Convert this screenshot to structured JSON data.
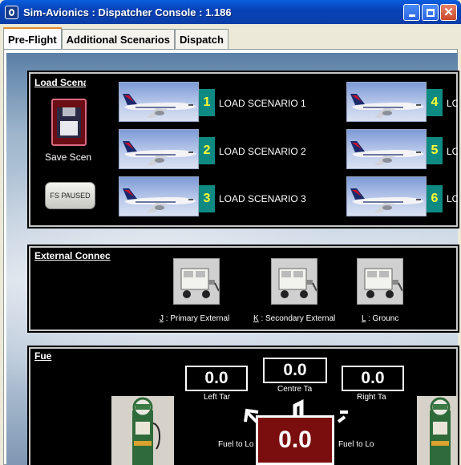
{
  "window": {
    "title": "Sim-Avionics : Dispatcher Console : 1.186"
  },
  "tabs": [
    {
      "label": "Pre-Flight",
      "active": true
    },
    {
      "label": "Additional Scenarios",
      "active": false
    },
    {
      "label": "Dispatch",
      "active": false
    }
  ],
  "load_panel": {
    "title": "Load Scena",
    "save_label": "Save Scen",
    "fs_paused_label": "FS PAUSED",
    "scenarios": [
      {
        "number": "1",
        "label": "LOAD SCENARIO 1"
      },
      {
        "number": "2",
        "label": "LOAD SCENARIO 2"
      },
      {
        "number": "3",
        "label": "LOAD SCENARIO 3"
      },
      {
        "number": "4",
        "label": "LO"
      },
      {
        "number": "5",
        "label": "LO"
      },
      {
        "number": "6",
        "label": "LO"
      }
    ]
  },
  "external_panel": {
    "title": "External Connec",
    "units": [
      {
        "key": "J",
        "label": " : Primary External"
      },
      {
        "key": "K",
        "label": " : Secondary External"
      },
      {
        "key": "L",
        "label": " : Grounc"
      }
    ]
  },
  "fuel_panel": {
    "title": "Fue",
    "left_tank": {
      "value": "0.0",
      "label": "Left Tar"
    },
    "centre_tank": {
      "value": "0.0",
      "label": "Centre Ta"
    },
    "right_tank": {
      "value": "0.0",
      "label": "Right Ta"
    },
    "fuel_to_left_label": "Fuel to Lo",
    "fuel_to_right_label": "Fuel to Lo",
    "main_value": "0.0"
  },
  "colors": {
    "title_bar": "#0842b8",
    "tile_teal": "#0f8a83",
    "tile_digit": "#ffff33",
    "fuel_main_bg": "#7a0e0e"
  }
}
